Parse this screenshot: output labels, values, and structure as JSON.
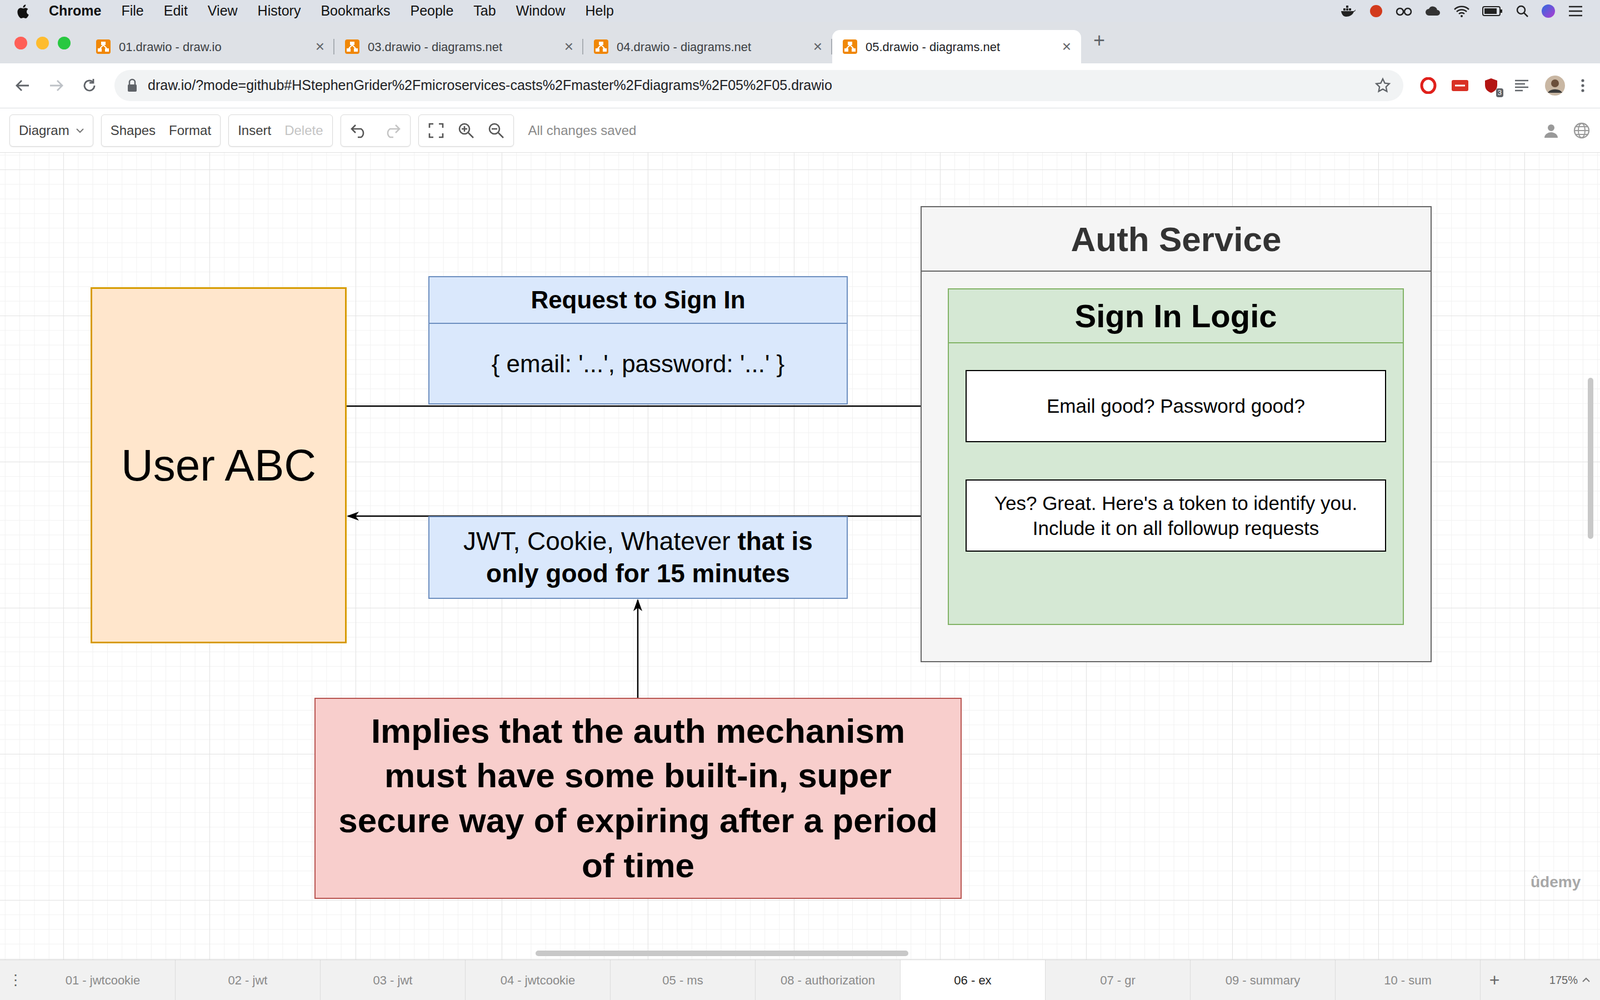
{
  "menubar": {
    "app": "Chrome",
    "items": [
      "File",
      "Edit",
      "View",
      "History",
      "Bookmarks",
      "People",
      "Tab",
      "Window",
      "Help"
    ]
  },
  "browser": {
    "tabs": [
      {
        "label": "01.drawio - draw.io",
        "selected": false
      },
      {
        "label": "03.drawio - diagrams.net",
        "selected": false
      },
      {
        "label": "04.drawio - diagrams.net",
        "selected": false
      },
      {
        "label": "05.drawio - diagrams.net",
        "selected": true
      }
    ],
    "tab_close": "×",
    "new_tab": "+",
    "url": "draw.io/?mode=github#HStephenGrider%2Fmicroservices-casts%2Fmaster%2Fdiagrams%2F05%2F05.drawio",
    "extension_badge": "3"
  },
  "toolbar": {
    "groups": [
      [
        {
          "label": "Diagram",
          "disabled": false
        }
      ],
      [
        {
          "label": "Shapes",
          "disabled": false
        },
        {
          "label": "Format",
          "disabled": false
        }
      ],
      [
        {
          "label": "Insert",
          "disabled": false
        },
        {
          "label": "Delete",
          "disabled": true
        }
      ]
    ],
    "history": {
      "undo_disabled": false,
      "redo_disabled": true
    },
    "status": "All changes saved"
  },
  "diagram": {
    "user": {
      "label": "User ABC"
    },
    "request": {
      "title": "Request to Sign In",
      "body": "{ email: '...', password: '...' }"
    },
    "response": {
      "segments": [
        {
          "text": "JWT, Cookie, Whatever ",
          "bold": false
        },
        {
          "text": "that is only good for 15 minutes",
          "bold": true
        }
      ]
    },
    "service": {
      "title": "Auth Service",
      "logic": {
        "title": "Sign In Logic",
        "steps": [
          "Email good? Password good?",
          "Yes? Great. Here's a token to identify you. Include it on all followup requests"
        ]
      }
    },
    "note": "Implies that the auth mechanism must have some built-in, super secure way of expiring after a period of time"
  },
  "pages": {
    "menu": "⋮",
    "tabs": [
      {
        "label": "01 - jwtcookie",
        "selected": false
      },
      {
        "label": "02 - jwt",
        "selected": false
      },
      {
        "label": "03 - jwt",
        "selected": false
      },
      {
        "label": "04 - jwtcookie",
        "selected": false
      },
      {
        "label": "05 - ms",
        "selected": false
      },
      {
        "label": "08 - authorization",
        "selected": false
      },
      {
        "label": "06 - ex",
        "selected": true
      },
      {
        "label": "07 - gr",
        "selected": false
      },
      {
        "label": "09 - summary",
        "selected": false
      },
      {
        "label": "10 - sum",
        "selected": false
      }
    ],
    "add": "+",
    "zoom": "175%"
  },
  "watermark": "ûdemy"
}
